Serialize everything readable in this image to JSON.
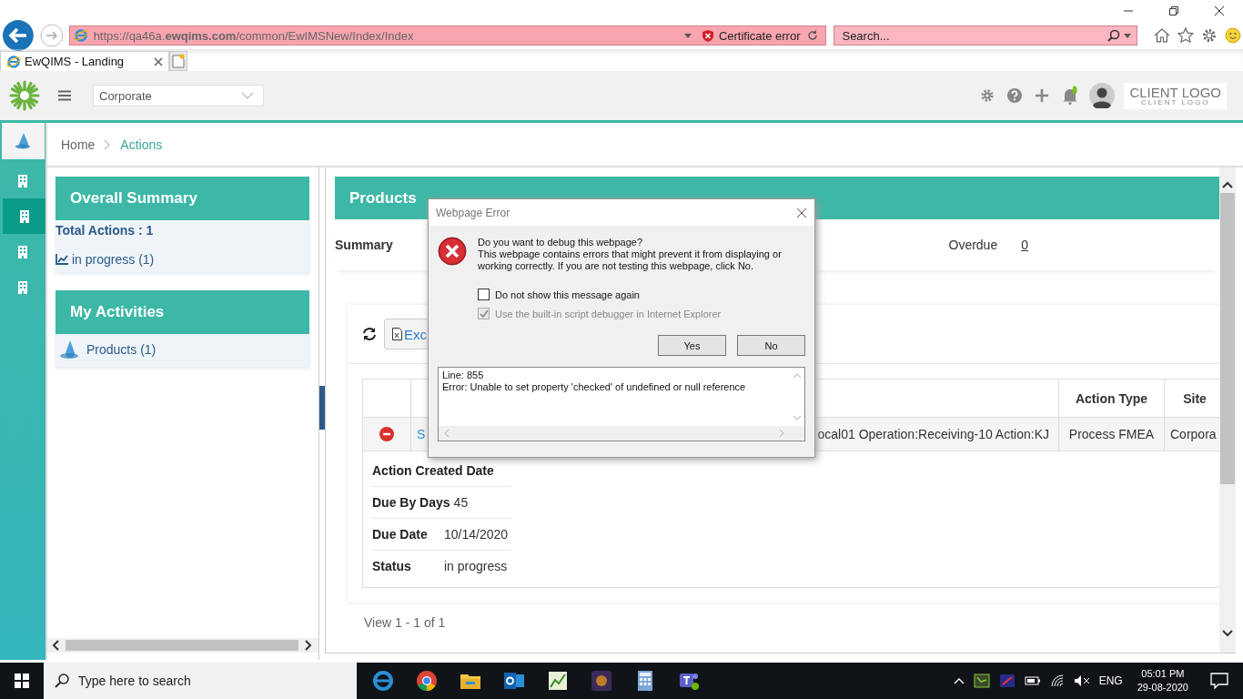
{
  "browser": {
    "url": "https://qa46a.**ewqims.com**/common/EwIMSNew/Index/Index",
    "certificate": "Certificate error",
    "search_placeholder": "Search...",
    "tab_title": "EwQIMS - Landing"
  },
  "header": {
    "site_select": "Corporate",
    "client_logo": "CLIENT LOGO",
    "client_logo_sub": "CLIENT LOGO"
  },
  "rail": [
    {
      "selected": false
    },
    {
      "selected": true
    },
    {
      "selected": false
    },
    {
      "selected": false
    }
  ],
  "breadcrumb": [
    "Home",
    "Actions"
  ],
  "overall_summary": {
    "title": "Overall Summary",
    "total": "Total Actions : 1",
    "status": "in progress (1)"
  },
  "my_activities": {
    "title": "My Activities",
    "items": [
      "Products (1)"
    ]
  },
  "products": {
    "title": "Products",
    "summary_label": "Summary",
    "overdue_label": "Overdue",
    "overdue_value": "0",
    "export_label": "Exc",
    "table": {
      "columns": [
        "Action Type",
        "Site"
      ],
      "row": {
        "cell_2": "S",
        "cell_3": "ocal01 Operation:Receiving-10 Action:KJ",
        "action_type": "Process FMEA",
        "site": "Corpora"
      }
    },
    "details": [
      {
        "label": "Action Created Date"
      },
      {
        "label": "Due By Days",
        "value": "45"
      },
      {
        "label": "Due Date",
        "value": "10/14/2020"
      },
      {
        "label": "Status",
        "value": "in progress"
      }
    ],
    "pager": "View 1 - 1 of 1"
  },
  "dialog": {
    "title": "Webpage Error",
    "heading": "Do you want to debug this webpage?",
    "message": "This webpage contains errors that might prevent it from displaying or working correctly. If you are not testing this webpage, click No.",
    "options": [
      {
        "label": "Do not show this message again",
        "checked": false,
        "disabled": false
      },
      {
        "label": "Use the built-in script debugger in Internet Explorer",
        "checked": true,
        "disabled": true
      }
    ],
    "buttons": [
      "Yes",
      "No"
    ],
    "details": [
      "Line: 855",
      "Error: Unable to set property 'checked' of undefined or null reference"
    ]
  },
  "taskbar": {
    "search_placeholder": "Type here to search",
    "language": "ENG",
    "time": "05:01 PM",
    "date": "29-08-2020"
  }
}
